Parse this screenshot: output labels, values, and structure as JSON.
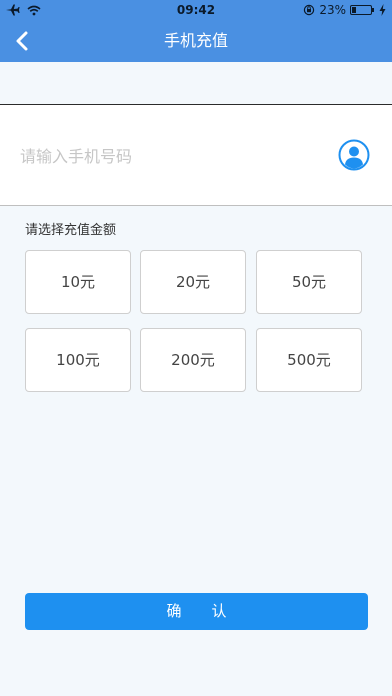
{
  "status_bar": {
    "time": "09:42",
    "battery_text": "23%",
    "battery_level": 0.23,
    "icons": [
      "airplane-icon",
      "wifi-icon",
      "orientation-lock-icon",
      "battery-icon",
      "charging-icon"
    ]
  },
  "nav": {
    "title": "手机充值",
    "back_icon": "back-chevron-icon"
  },
  "phone": {
    "placeholder": "请输入手机号码",
    "value": "",
    "contact_icon": "contact-person-icon"
  },
  "amount_section": {
    "label": "请选择充值金额",
    "options": [
      "10元",
      "20元",
      "50元",
      "100元",
      "200元",
      "500元"
    ]
  },
  "confirm": {
    "label": "确　　认"
  },
  "colors": {
    "primary": "#4a90e2",
    "button": "#1e90f0",
    "background": "#f3f8fc"
  }
}
